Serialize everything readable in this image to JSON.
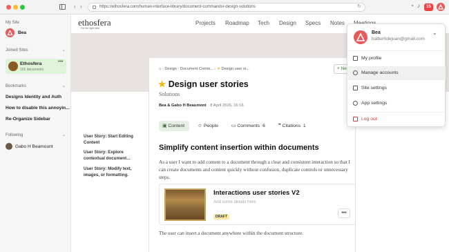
{
  "browser": {
    "url": "https://ethosfera.com/human-interface-library/document-commands/-design-solutions",
    "notification_count": "15"
  },
  "sidebar": {
    "my_site_heading": "My Site",
    "my_site_user": "Bea",
    "joined_sites_heading": "Joined Sites",
    "site_name": "Ethosfera",
    "site_docs": "101 documents",
    "bookmarks_heading": "Bookmarks",
    "bookmarks": [
      "Designs Identity and Auth",
      "How to disable this annoyin...",
      "Re-Organize Sidebar"
    ],
    "following_heading": "Following",
    "following_user": "Gabo H Beamount"
  },
  "header": {
    "logo": "ethosfera",
    "tagline": "For the right think",
    "nav": [
      "Projects",
      "Roadmap",
      "Tech",
      "Design",
      "Specs",
      "Notes",
      "Meetings"
    ]
  },
  "doc": {
    "breadcrumb_design": "Design",
    "breadcrumb_commands": "Document Comm...",
    "breadcrumb_current": "Design user st...",
    "title": "Design user stories",
    "subtitle": "Solutions",
    "authors": "Bea & Gabo H Beaumont",
    "date": "8 April 2026, 16:16",
    "tabs": {
      "content": "Content",
      "people": "People",
      "comments": "Comments",
      "comments_count": "6",
      "citations": "Citations",
      "citations_count": "1"
    },
    "new_button": "+ New",
    "toc": [
      "User Story: Start Editing Content",
      "User Story: Explore contextual document...",
      "User Story: Modify text, images, or formatting."
    ],
    "section_title": "Simplify content insertion within documents",
    "paragraph": "As a user I want to add content to a document through a clear and consistent interaction so that I can create documents and content quickly without confusion, duplicate controls or unnecessary steps.",
    "embed": {
      "title": "Interactions user stories V2",
      "subtitle": "Add some details here",
      "badge": "DRAFT",
      "menu": "•••"
    },
    "paragraph2": "The user can insert a document anywhere within the document structure."
  },
  "dropdown": {
    "name": "Bea",
    "email": "balbertidejuan@gmail.com",
    "items": [
      "My profile",
      "Manage accounts",
      "Site settings",
      "App settings"
    ],
    "logout": "Log out"
  },
  "colors": {
    "accent_green": "#dff3d8",
    "avatar_red": "#e85a5a",
    "logout_red": "#d33333"
  }
}
